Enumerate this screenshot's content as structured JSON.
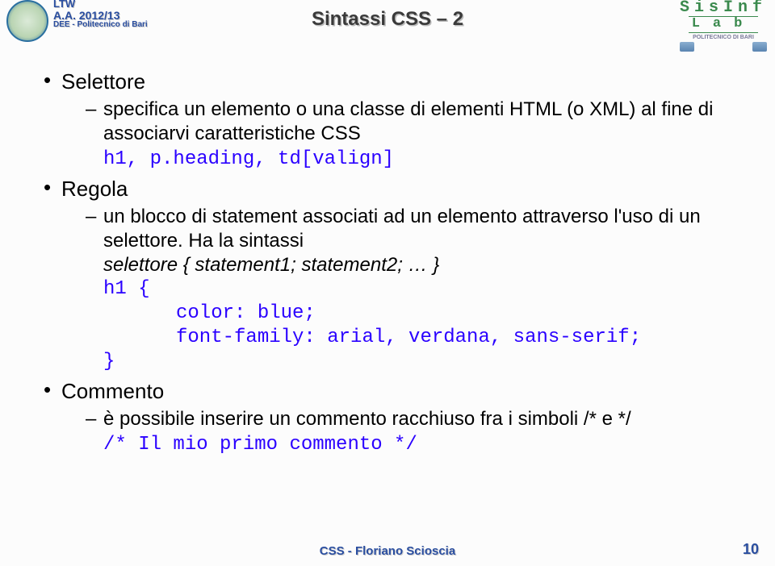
{
  "header": {
    "ltw": "LTW",
    "aa": "A.A. 2012/13",
    "dee": "DEE - Politecnico di Bari",
    "title": "Sintassi CSS – 2",
    "sisinf": "SisInf",
    "lab": "Lab",
    "poli": "POLITECNICO DI BARI"
  },
  "content": {
    "selettore": "Selettore",
    "sel_desc": "specifica un elemento o una classe di elementi HTML (o XML) al fine di associarvi caratteristiche CSS",
    "sel_code": "h1, p.heading, td[valign]",
    "regola": "Regola",
    "reg_desc_a": "un blocco di statement associati ad un elemento attraverso l'uso di un selettore. Ha la sintassi",
    "reg_syntax": "selettore { statement1; statement2; … }",
    "reg_code_l1": "h1 {",
    "reg_code_l2": "color: blue;",
    "reg_code_l3": "font-family: arial, verdana, sans-serif;",
    "reg_code_l4": "}",
    "commento": "Commento",
    "com_desc": "è possibile inserire un commento racchiuso fra i simboli /* e */",
    "com_code": "/* Il mio primo commento */"
  },
  "footer": {
    "text": "CSS - Floriano Scioscia",
    "page": "10"
  }
}
